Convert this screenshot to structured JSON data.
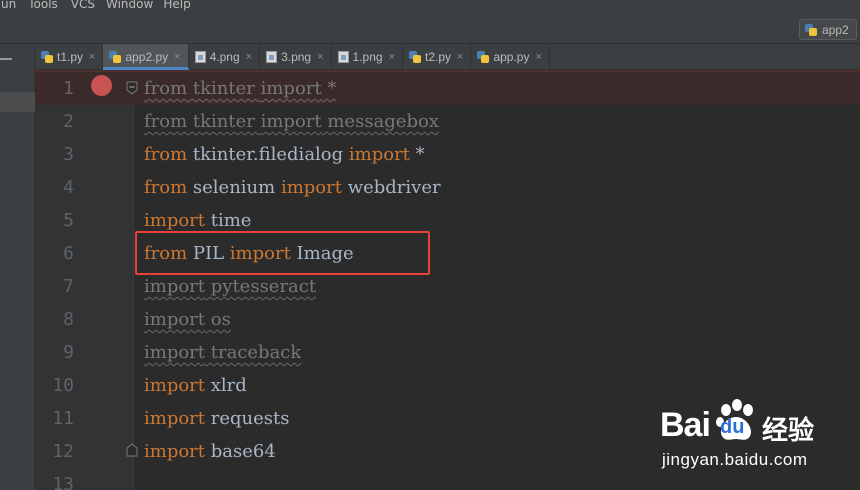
{
  "menu": [
    "un",
    "Tools",
    "VCS",
    "Window",
    "Help"
  ],
  "run_config": {
    "label": "app2",
    "icon": "python-icon"
  },
  "tabs": [
    {
      "label": "t1.py",
      "icon": "python-file-icon",
      "active": false
    },
    {
      "label": "app2.py",
      "icon": "python-file-icon",
      "active": true
    },
    {
      "label": "4.png",
      "icon": "image-file-icon",
      "active": false
    },
    {
      "label": "3.png",
      "icon": "image-file-icon",
      "active": false
    },
    {
      "label": "1.png",
      "icon": "image-file-icon",
      "active": false
    },
    {
      "label": "t2.py",
      "icon": "python-file-icon",
      "active": false
    },
    {
      "label": "app.py",
      "icon": "python-file-icon",
      "active": false
    }
  ],
  "tab_close_glyph": "×",
  "editor": {
    "lines": [
      {
        "no": "1",
        "kw1": "from",
        "mod": " tkinter ",
        "kw2": "import",
        "rest": " *",
        "unused": true
      },
      {
        "no": "2",
        "kw1": "from",
        "mod": " tkinter ",
        "kw2": "import",
        "rest": " messagebox",
        "unused": true
      },
      {
        "no": "3",
        "kw1": "from",
        "mod": " tkinter.filedialog ",
        "kw2": "import",
        "rest": " *",
        "unused": false
      },
      {
        "no": "4",
        "kw1": "from",
        "mod": " selenium ",
        "kw2": "import",
        "rest": " webdriver",
        "unused": false
      },
      {
        "no": "5",
        "kw1": "import",
        "mod": " time",
        "kw2": "",
        "rest": "",
        "unused": false
      },
      {
        "no": "6",
        "kw1": "from",
        "mod": " PIL ",
        "kw2": "import",
        "rest": " Image",
        "unused": false
      },
      {
        "no": "7",
        "kw1": "import",
        "mod": " pytesseract",
        "kw2": "",
        "rest": "",
        "unused": true
      },
      {
        "no": "8",
        "kw1": "import",
        "mod": " os",
        "kw2": "",
        "rest": "",
        "unused": true
      },
      {
        "no": "9",
        "kw1": "import",
        "mod": " traceback",
        "kw2": "",
        "rest": "",
        "unused": true
      },
      {
        "no": "10",
        "kw1": "import",
        "mod": " xlrd",
        "kw2": "",
        "rest": "",
        "unused": false
      },
      {
        "no": "11",
        "kw1": "import",
        "mod": " requests",
        "kw2": "",
        "rest": "",
        "unused": false
      },
      {
        "no": "12",
        "kw1": "import",
        "mod": " base64",
        "kw2": "",
        "rest": "",
        "unused": false
      },
      {
        "no": "13",
        "kw1": "",
        "mod": "",
        "kw2": "",
        "rest": "",
        "unused": false
      }
    ],
    "breakpoint_line": "1",
    "highlighted_line": "6"
  },
  "colors": {
    "keyword": "#cc7832",
    "identifier": "#a9b7c6",
    "unused": "#787878",
    "breakpoint": "#c75450",
    "highlight_box": "#e8413a",
    "active_tab_underline": "#4a88c7"
  },
  "watermark": {
    "bai": "Bai",
    "du": "du",
    "jingyan": "经验",
    "url": "jingyan.baidu.com"
  }
}
